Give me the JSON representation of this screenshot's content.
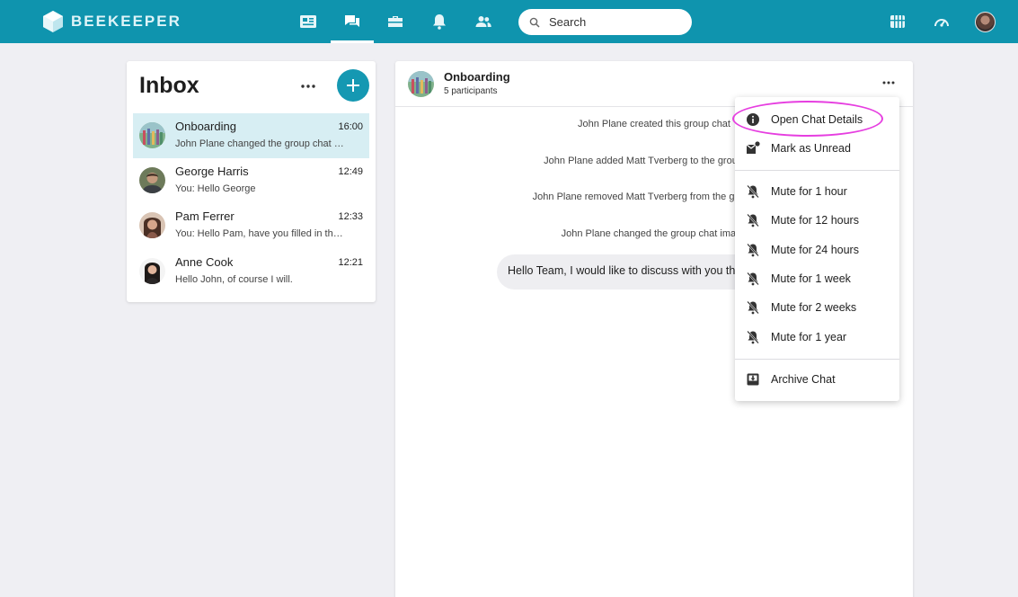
{
  "brand": {
    "name": "BEEKEEPER"
  },
  "nav": {
    "items": [
      {
        "icon": "news-icon"
      },
      {
        "icon": "chat-icon",
        "active": true
      },
      {
        "icon": "toolbox-icon"
      },
      {
        "icon": "bell-icon"
      },
      {
        "icon": "people-icon"
      }
    ],
    "search_placeholder": "Search",
    "right_icons": [
      "streams-icon",
      "dashboard-icon",
      "user-avatar"
    ]
  },
  "inbox": {
    "title": "Inbox",
    "chats": [
      {
        "name": "Onboarding",
        "time": "16:00",
        "preview": "John Plane changed the group chat image",
        "selected": true
      },
      {
        "name": "George Harris",
        "time": "12:49",
        "preview": "You: Hello George"
      },
      {
        "name": "Pam Ferrer",
        "time": "12:33",
        "preview": "You: Hello Pam, have you filled in the form?"
      },
      {
        "name": "Anne Cook",
        "time": "12:21",
        "preview": "Hello John, of course I will."
      }
    ]
  },
  "conversation": {
    "title": "Onboarding",
    "participants": "5 participants",
    "system_messages": [
      "John Plane created this group chat",
      "John Plane added Matt Tverberg to the group chat",
      "John Plane removed Matt Tverberg from the group chat",
      "John Plane changed the group chat image"
    ],
    "message": "Hello Team, I would like to discuss with you the onboarding plan"
  },
  "menu": {
    "open_details": "Open Chat Details",
    "mark_unread": "Mark as Unread",
    "mute": [
      "Mute for 1 hour",
      "Mute for 12 hours",
      "Mute for 24 hours",
      "Mute for 1 week",
      "Mute for 2 weeks",
      "Mute for 1 year"
    ],
    "archive": "Archive Chat"
  },
  "colors": {
    "topbar": "#0f94ae",
    "accent": "#1598b2",
    "selected_row": "#d7eef3",
    "annotation": "#e63ee0"
  }
}
